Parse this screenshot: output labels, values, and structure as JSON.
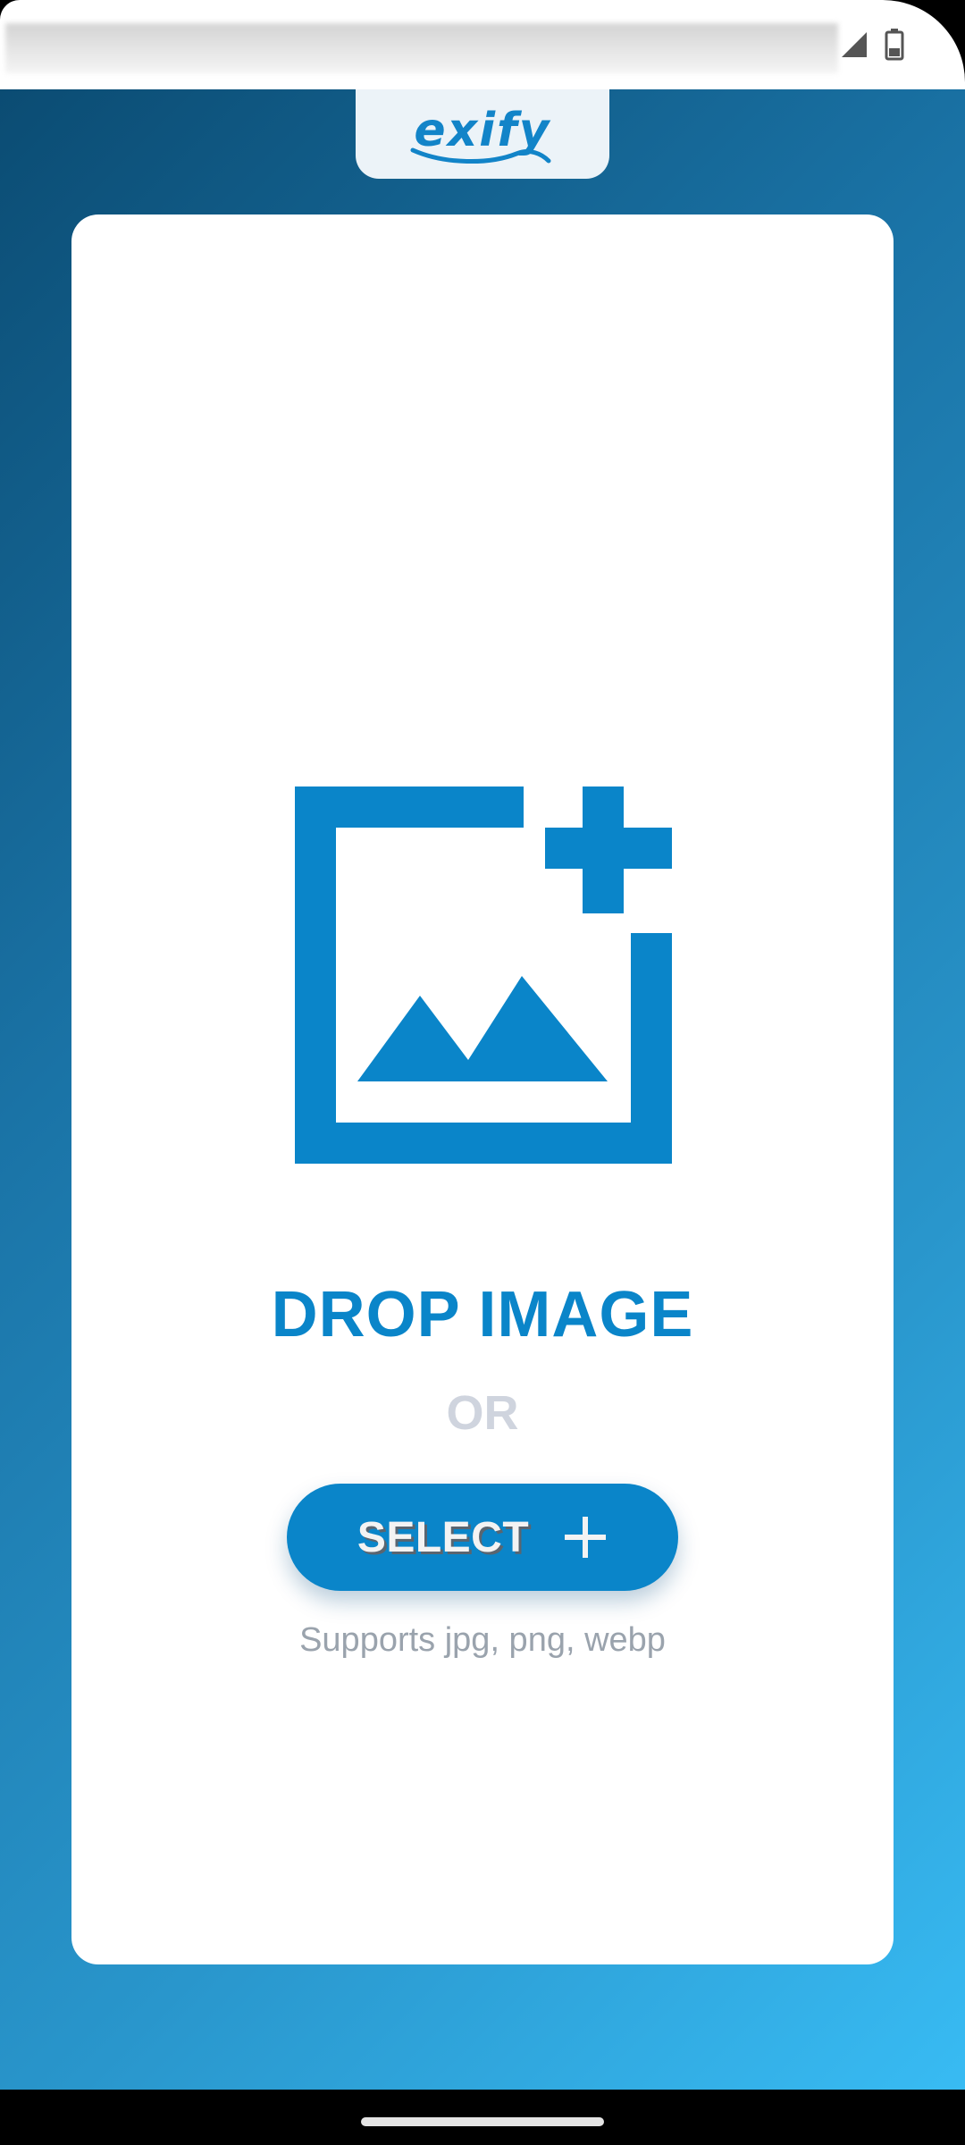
{
  "app": {
    "logo_text": "exify",
    "brand_color": "#0a85c9"
  },
  "status_bar": {
    "icons": [
      "signal-icon",
      "battery-icon"
    ]
  },
  "drop_zone": {
    "icon": "add-image-icon",
    "title": "DROP IMAGE",
    "or_text": "OR",
    "select_label": "SELECT",
    "select_icon": "plus-icon",
    "supports_text": "Supports jpg, png, webp"
  },
  "colors": {
    "accent": "#0a85c9",
    "muted_text": "#9aa3ad",
    "or_text": "#cfd4de",
    "background_start": "#0b4c73",
    "background_end": "#38bbf3"
  }
}
